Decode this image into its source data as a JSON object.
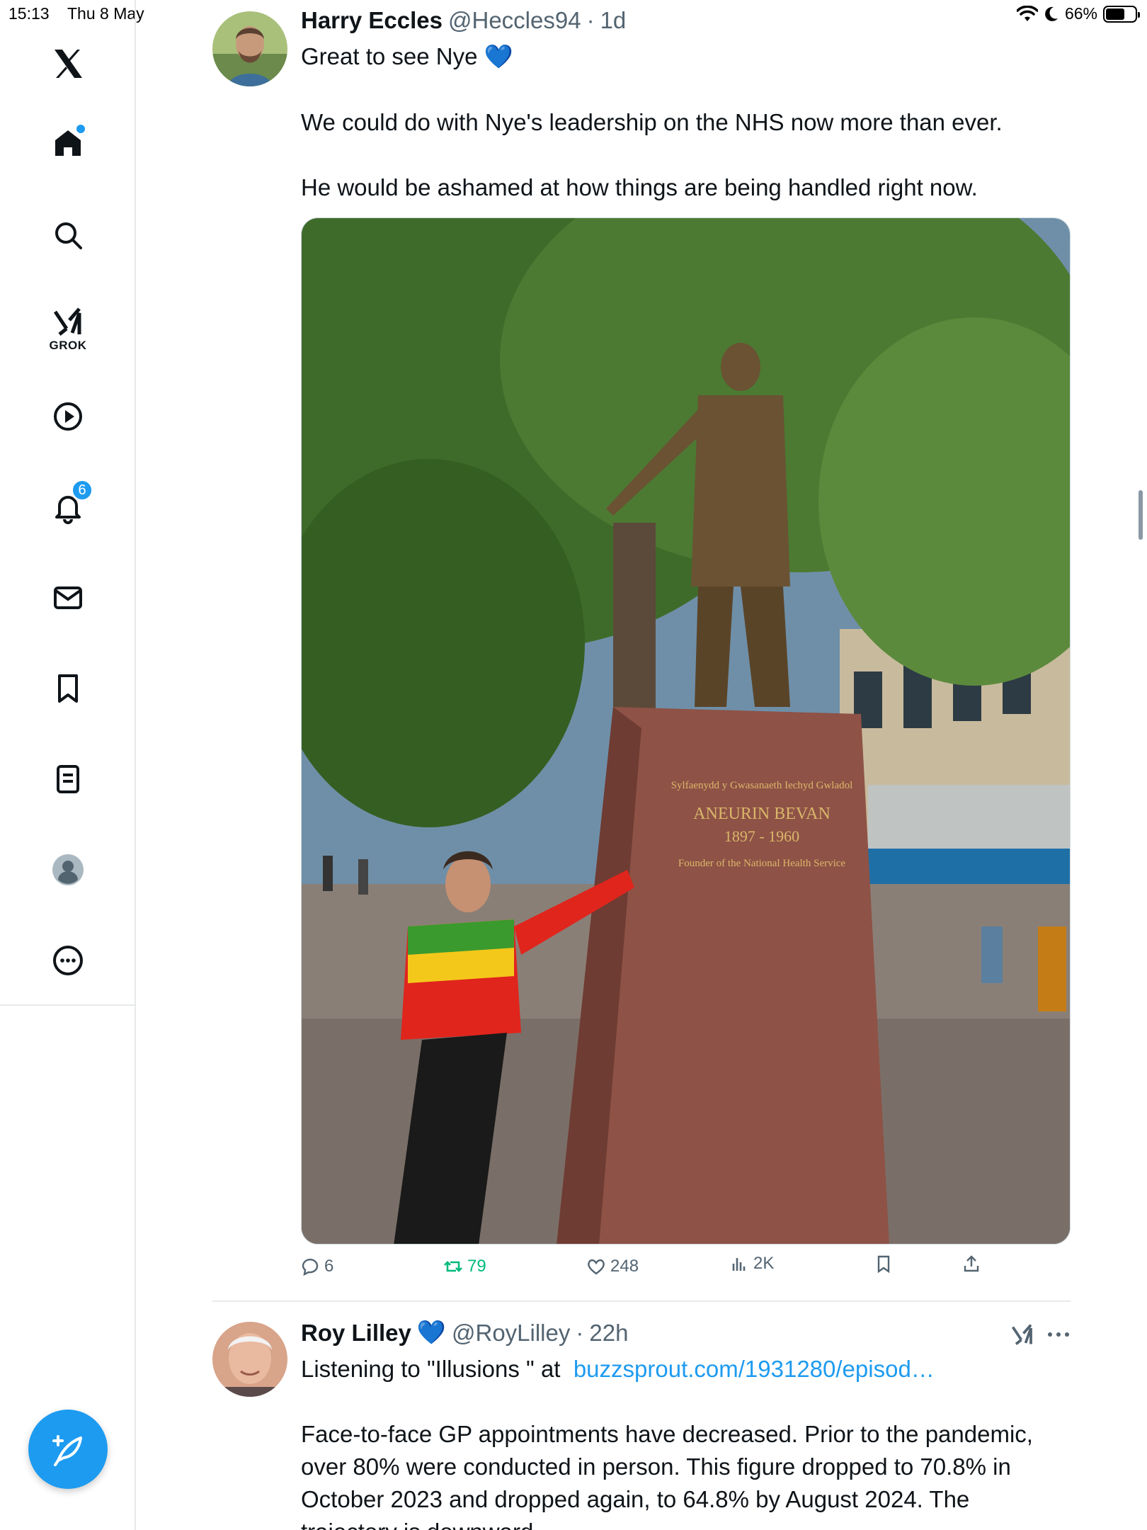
{
  "status_bar": {
    "time": "15:13",
    "date": "Thu 8 May",
    "battery": "66%",
    "battery_level": 0.66
  },
  "sidebar": {
    "items": [
      {
        "icon": "x-logo-icon"
      },
      {
        "icon": "home-icon"
      },
      {
        "icon": "search-icon"
      },
      {
        "icon": "grok-icon",
        "label": "GROK"
      },
      {
        "icon": "video-play-icon"
      },
      {
        "icon": "notifications-bell-icon",
        "badge": "6"
      },
      {
        "icon": "messages-envelope-icon"
      },
      {
        "icon": "bookmark-icon"
      },
      {
        "icon": "lists-icon"
      },
      {
        "icon": "profile-icon"
      },
      {
        "icon": "more-icon"
      }
    ],
    "compose_icon": "compose-feather-icon"
  },
  "tweets": [
    {
      "name": "Harry Eccles",
      "handle": "@Heccles94",
      "sep": "·",
      "time": "1d",
      "text_lines": [
        "Great to see Nye 💙",
        "We could do with Nye's leadership on the NHS now more than ever.",
        "He would be ashamed at how things are being handled right now."
      ],
      "image_inscription": {
        "line1": "Sylfaenydd y Gwasanaeth Iechyd Gwladol",
        "line2": "ANEURIN BEVAN",
        "line3": "1897 - 1960",
        "line4": "Founder of the National Health Service"
      },
      "actions": {
        "replies": "6",
        "reposts": "79",
        "likes": "248",
        "views": "2K"
      }
    },
    {
      "name": "Roy Lilley",
      "verified": "💙",
      "handle": "@RoyLilley",
      "sep": "·",
      "time": "22h",
      "text_prefix": "Listening to \"Illusions \" at",
      "link": "buzzsprout.com/1931280/episod…",
      "text_lines": [
        "Face-to-face GP appointments have decreased. Prior to the pandemic,",
        "over 80% were conducted in person. This figure dropped to 70.8% in",
        "October 2023 and dropped again, to 64.8% by August 2024. The",
        "trajectory is downward"
      ]
    }
  ],
  "colors": {
    "accent": "#1d9bf0",
    "text": "#0f1419",
    "muted": "#536471",
    "repost_active": "#00ba7c"
  }
}
